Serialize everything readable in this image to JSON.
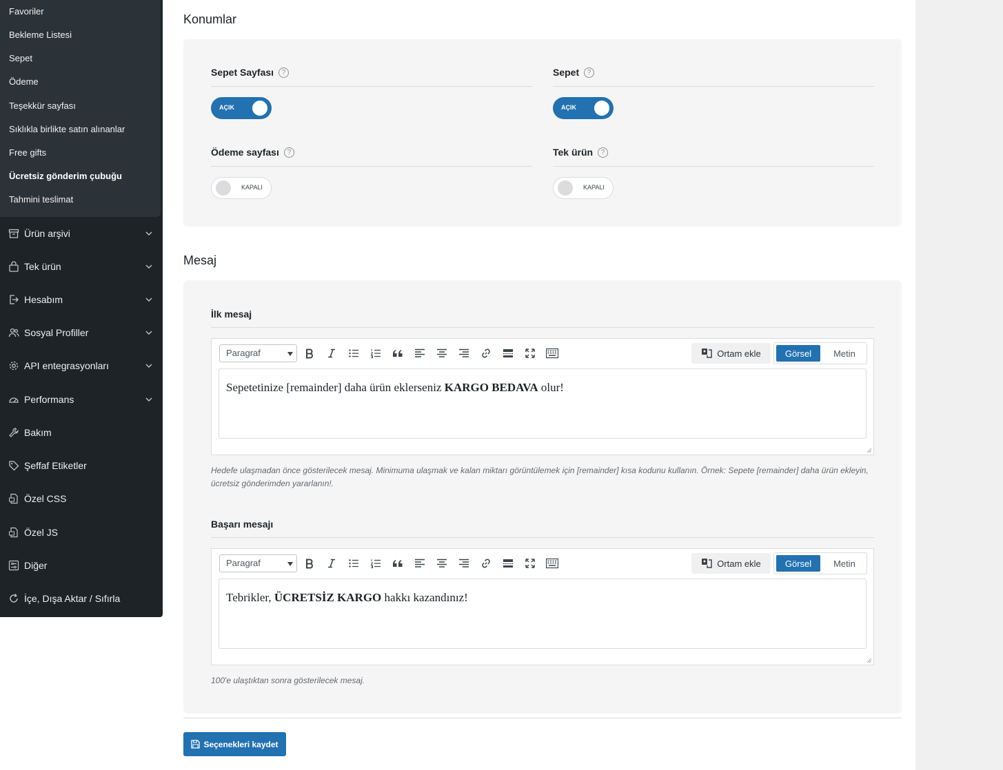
{
  "sidebar": {
    "submenu": [
      {
        "label": "Favoriler",
        "active": false
      },
      {
        "label": "Bekleme Listesi",
        "active": false
      },
      {
        "label": "Sepet",
        "active": false
      },
      {
        "label": "Ödeme",
        "active": false
      },
      {
        "label": "Teşekkür sayfası",
        "active": false
      },
      {
        "label": "Sıklıkla birlikte satın alınanlar",
        "active": false
      },
      {
        "label": "Free gifts",
        "active": false
      },
      {
        "label": "Ücretsiz gönderim çubuğu",
        "active": true
      },
      {
        "label": "Tahmini teslimat",
        "active": false
      }
    ],
    "menu": [
      {
        "label": "Ürün arşivi",
        "icon": "archive-icon",
        "has_chevron": true
      },
      {
        "label": "Tek ürün",
        "icon": "shopping-bag-icon",
        "has_chevron": true
      },
      {
        "label": "Hesabım",
        "icon": "login-icon",
        "has_chevron": true
      },
      {
        "label": "Sosyal Profiller",
        "icon": "users-icon",
        "has_chevron": true
      },
      {
        "label": "API entegrasyonları",
        "icon": "gear-icon",
        "has_chevron": true
      },
      {
        "label": "Performans",
        "icon": "gauge-icon",
        "has_chevron": true
      },
      {
        "label": "Bakım",
        "icon": "wrench-icon",
        "has_chevron": false
      },
      {
        "label": "Şeffaf Etiketler",
        "icon": "tag-icon",
        "has_chevron": false
      },
      {
        "label": "Özel CSS",
        "icon": "css-file-icon",
        "has_chevron": false
      },
      {
        "label": "Özel JS",
        "icon": "js-file-icon",
        "has_chevron": false
      },
      {
        "label": "Diğer",
        "icon": "sliders-icon",
        "has_chevron": false
      },
      {
        "label": "İçe, Dışa Aktar / Sıfırla",
        "icon": "refresh-icon",
        "has_chevron": false
      }
    ]
  },
  "locations": {
    "title": "Konumlar",
    "fields": [
      {
        "label": "Sepet Sayfası",
        "state": "on",
        "state_label": "AÇIK"
      },
      {
        "label": "Sepet",
        "state": "on",
        "state_label": "AÇIK"
      },
      {
        "label": "Ödeme sayfası",
        "state": "off",
        "state_label": "KAPALI"
      },
      {
        "label": "Tek ürün",
        "state": "off",
        "state_label": "KAPALI"
      }
    ],
    "help_glyph": "?"
  },
  "message": {
    "title": "Mesaj",
    "first": {
      "label": "İlk mesaj",
      "content_before": "Sepetetinize [remainder] daha ürün eklerseniz ",
      "content_bold": "KARGO BEDAVA",
      "content_after": " olur!",
      "description": "Hedefe ulaşmadan önce gösterilecek mesaj. Minimuma ulaşmak ve kalan miktarı görüntülemek için [remainder] kısa kodunu kullanın. Örnek: Sepete [remainder] daha ürün ekleyin, ücretsiz gönderimden yararlanın!."
    },
    "success": {
      "label": "Başarı mesajı",
      "content_before": "Tebrikler, ",
      "content_bold": "ÜCRETSİZ KARGO",
      "content_after": " hakkı kazandınız!",
      "description": "100'e ulaştıktan sonra gösterilecek mesaj."
    }
  },
  "editor": {
    "format_select": "Paragraf",
    "add_media": "Ortam ekle",
    "mode_visual": "Görsel",
    "mode_text": "Metin"
  },
  "actions": {
    "save_label": "Seçenekleri kaydet"
  },
  "colors": {
    "accent": "#2271b1",
    "sidebar_bg": "#1d2327",
    "submenu_bg": "#2c3338",
    "panel_bg": "#f5f5f5"
  }
}
